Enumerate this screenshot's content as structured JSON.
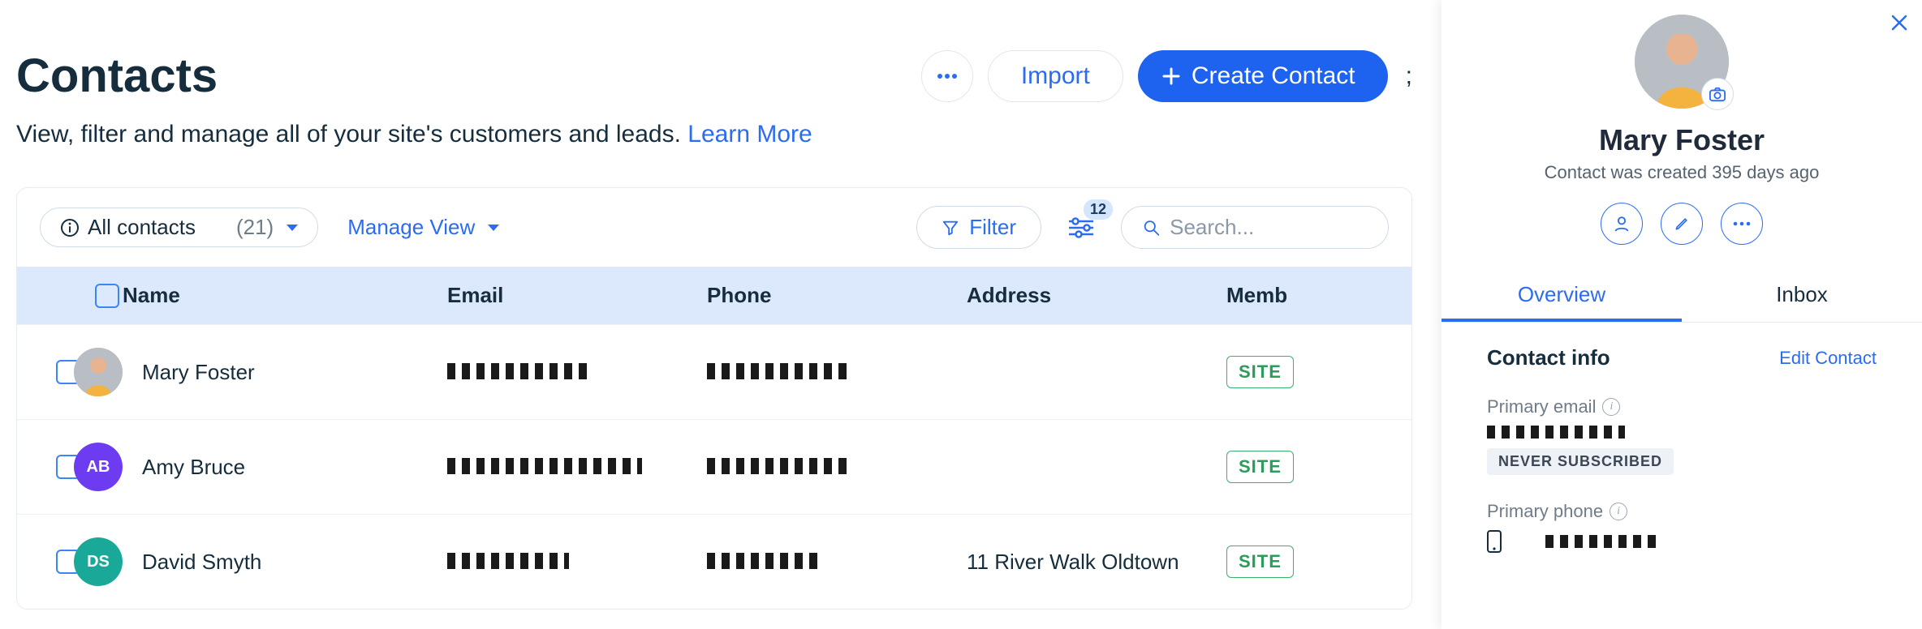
{
  "header": {
    "title": "Contacts",
    "subtitle_text": "View, filter and manage all of your site's customers and leads. ",
    "learn_more": "Learn More",
    "import_label": "Import",
    "create_label": "Create Contact",
    "trailing_char": ";"
  },
  "toolbar": {
    "view_label": "All contacts",
    "count_label": "(21)",
    "manage_view_label": "Manage View",
    "filter_label": "Filter",
    "adjust_badge": "12",
    "search_placeholder": "Search..."
  },
  "columns": {
    "name": "Name",
    "email": "Email",
    "phone": "Phone",
    "address": "Address",
    "member": "Memb"
  },
  "rows": [
    {
      "name": "Mary Foster",
      "avatar_type": "img",
      "initials": "",
      "address": "",
      "badge": "SITE"
    },
    {
      "name": "Amy Bruce",
      "avatar_type": "purple",
      "initials": "AB",
      "address": "",
      "badge": "SITE"
    },
    {
      "name": "David Smyth",
      "avatar_type": "teal",
      "initials": "DS",
      "address": "11 River Walk Oldtown",
      "badge": "SITE"
    }
  ],
  "panel": {
    "name": "Mary Foster",
    "subtitle": "Contact was created 395 days ago",
    "tabs": {
      "overview": "Overview",
      "inbox": "Inbox"
    },
    "section_title": "Contact info",
    "edit_label": "Edit Contact",
    "primary_email_label": "Primary email",
    "never_subscribed": "NEVER SUBSCRIBED",
    "primary_phone_label": "Primary phone"
  }
}
